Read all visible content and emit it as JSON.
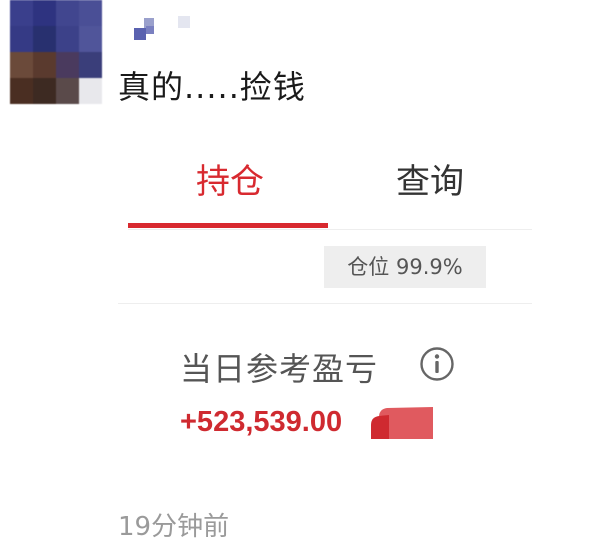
{
  "post": {
    "text": "真的.....捡钱"
  },
  "tabs": [
    {
      "label": "持仓",
      "active": true
    },
    {
      "label": "查询",
      "active": false
    }
  ],
  "position_badge": "仓位 99.9%",
  "pnl": {
    "label": "当日参考盈亏",
    "value": "+523,539.00",
    "info_icon": "info-icon"
  },
  "timestamp": "19分钟前",
  "colors": {
    "accent": "#d8292f",
    "profit": "#cf2a30",
    "muted": "#9a9a9a"
  }
}
